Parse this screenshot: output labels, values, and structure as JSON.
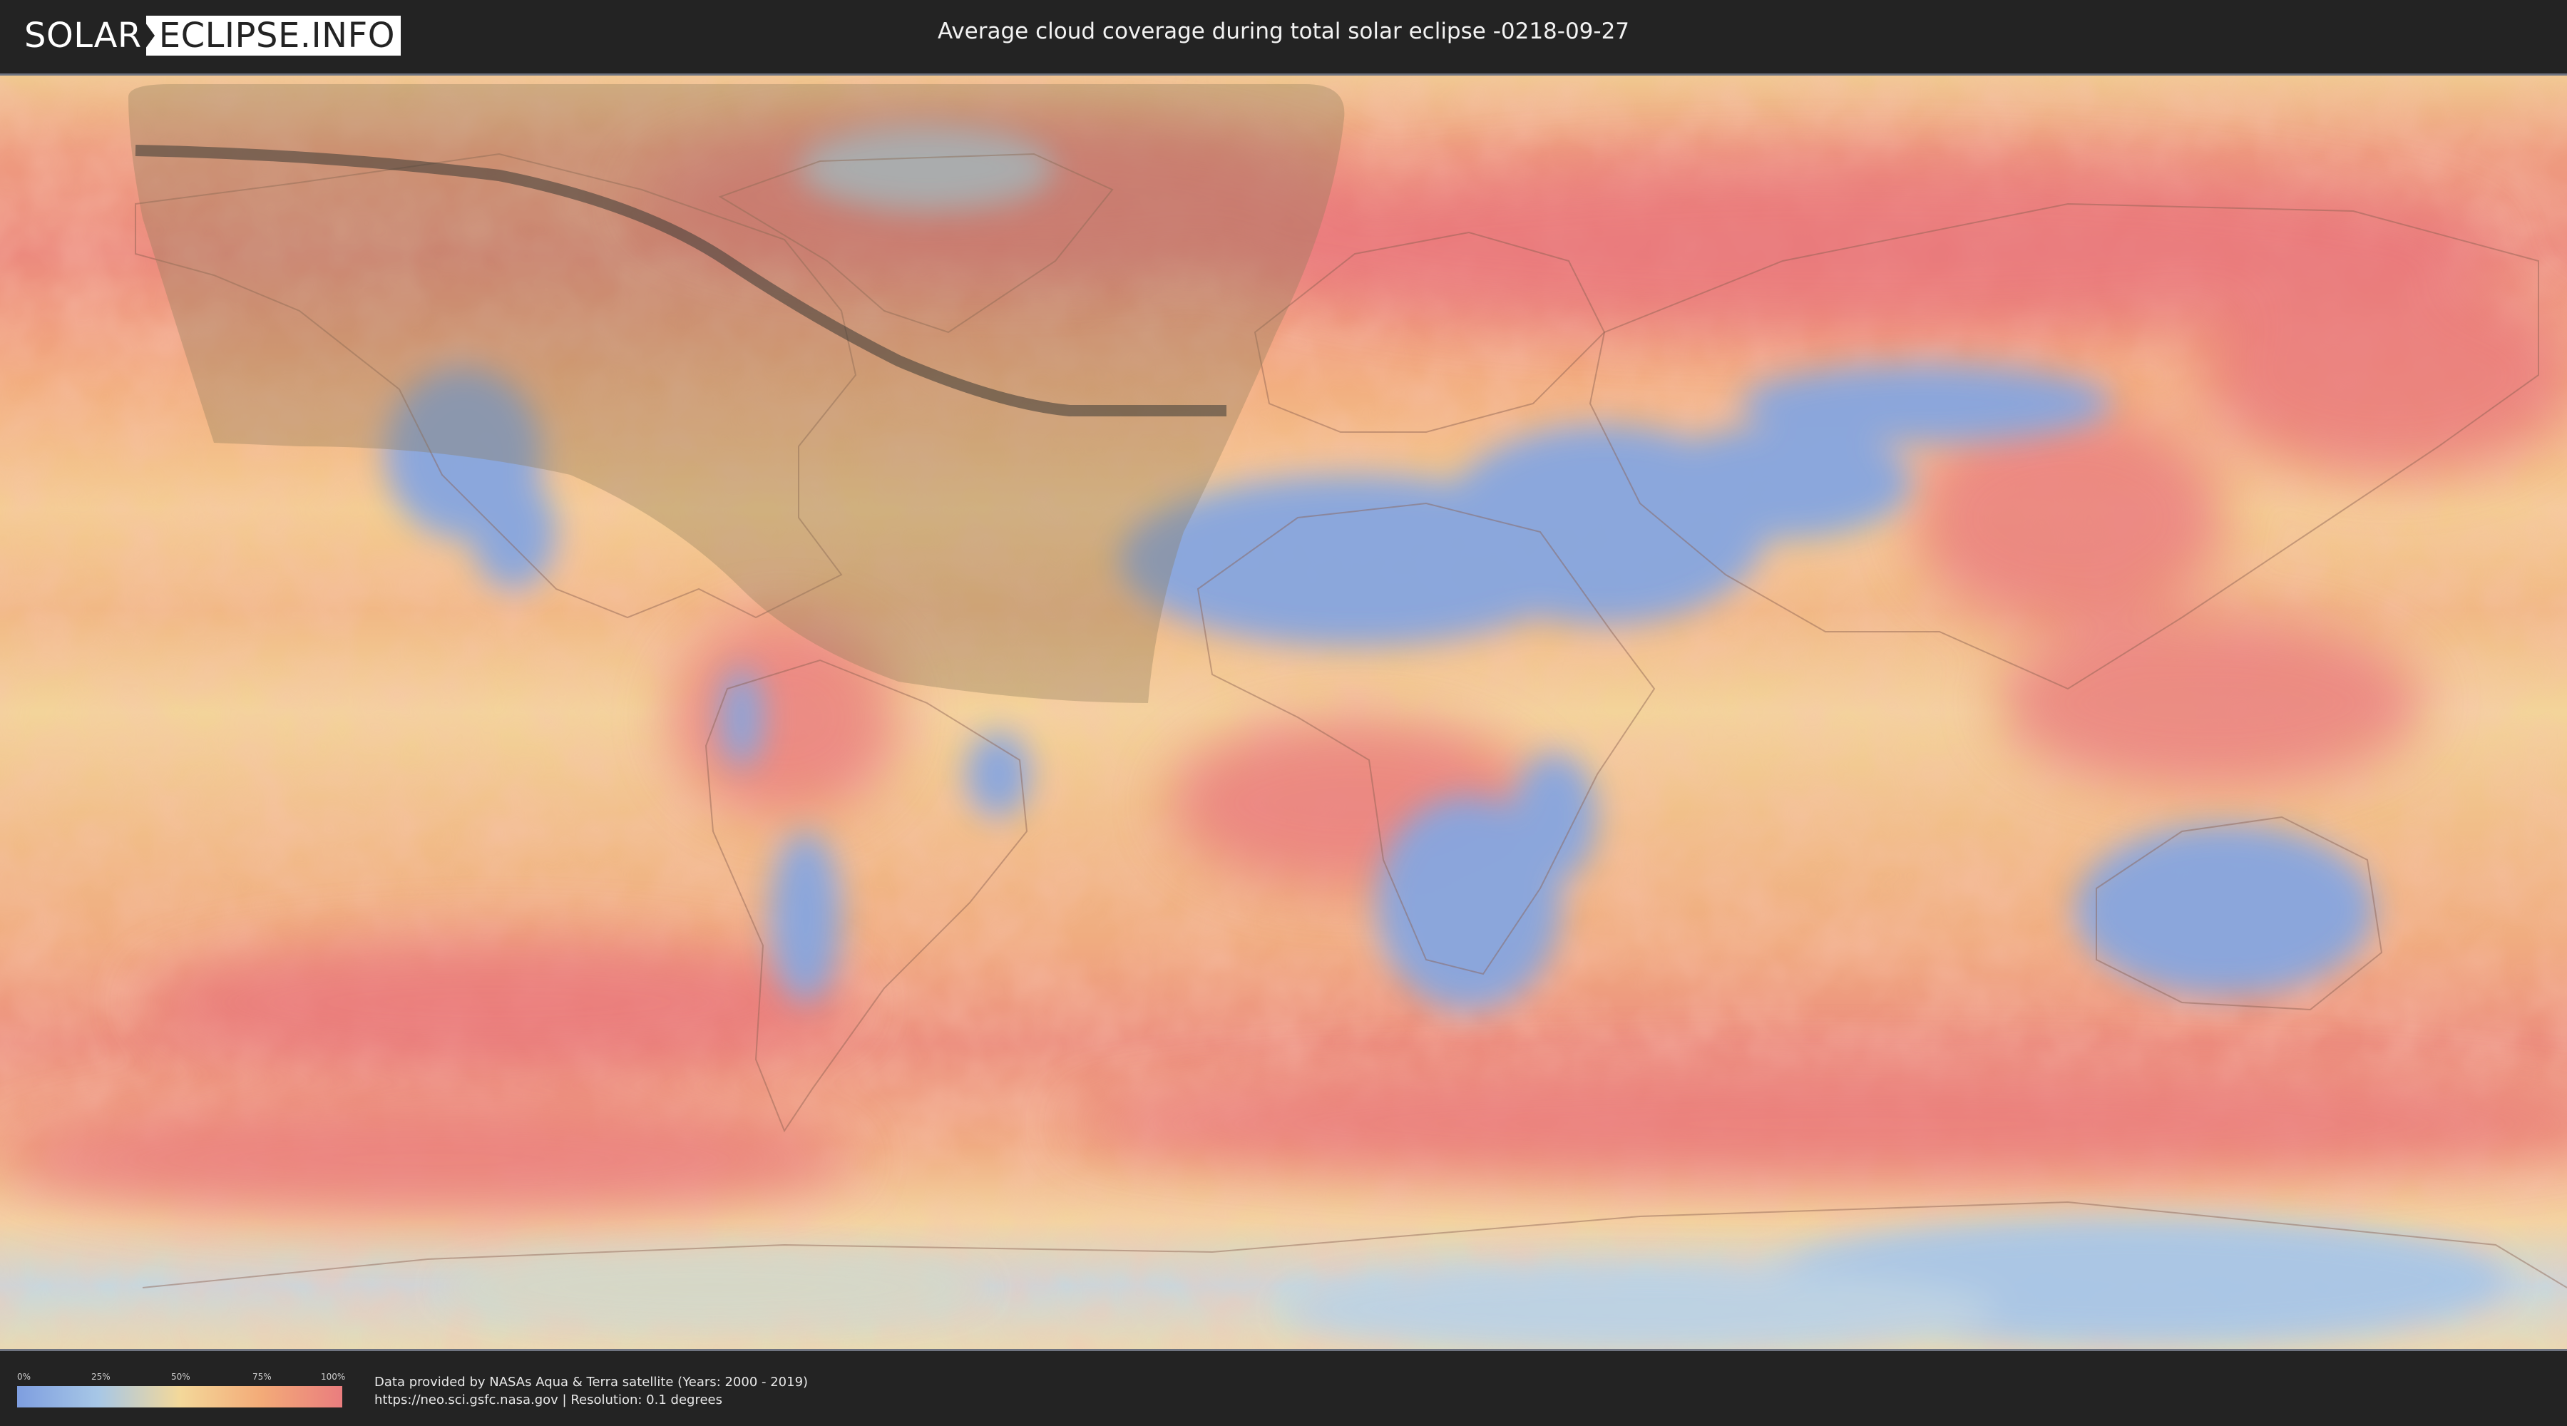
{
  "header": {
    "logo_left": "SOLAR",
    "logo_right": "ECLIPSE.INFO",
    "title": "Average cloud coverage during total solar eclipse -0218-09-27"
  },
  "map": {
    "layer": "average cloud coverage",
    "eclipse_visibility_region": "shaded",
    "path_of_totality": "dark band",
    "colors": {
      "clear": "#7e9ee0",
      "low": "#a7c7e6",
      "mid": "#f3d89a",
      "high": "#f3ab78",
      "overcast": "#ea7d7e",
      "shadow": "#8c7a5a",
      "path": "#3d3a34"
    }
  },
  "legend": {
    "ticks": [
      "0%",
      "25%",
      "50%",
      "75%",
      "100%"
    ]
  },
  "footer": {
    "credit_line1": "Data provided by NASAs Aqua & Terra satellite (Years: 2000 - 2019)",
    "credit_line2": "https://neo.sci.gsfc.nasa.gov | Resolution: 0.1 degrees"
  }
}
